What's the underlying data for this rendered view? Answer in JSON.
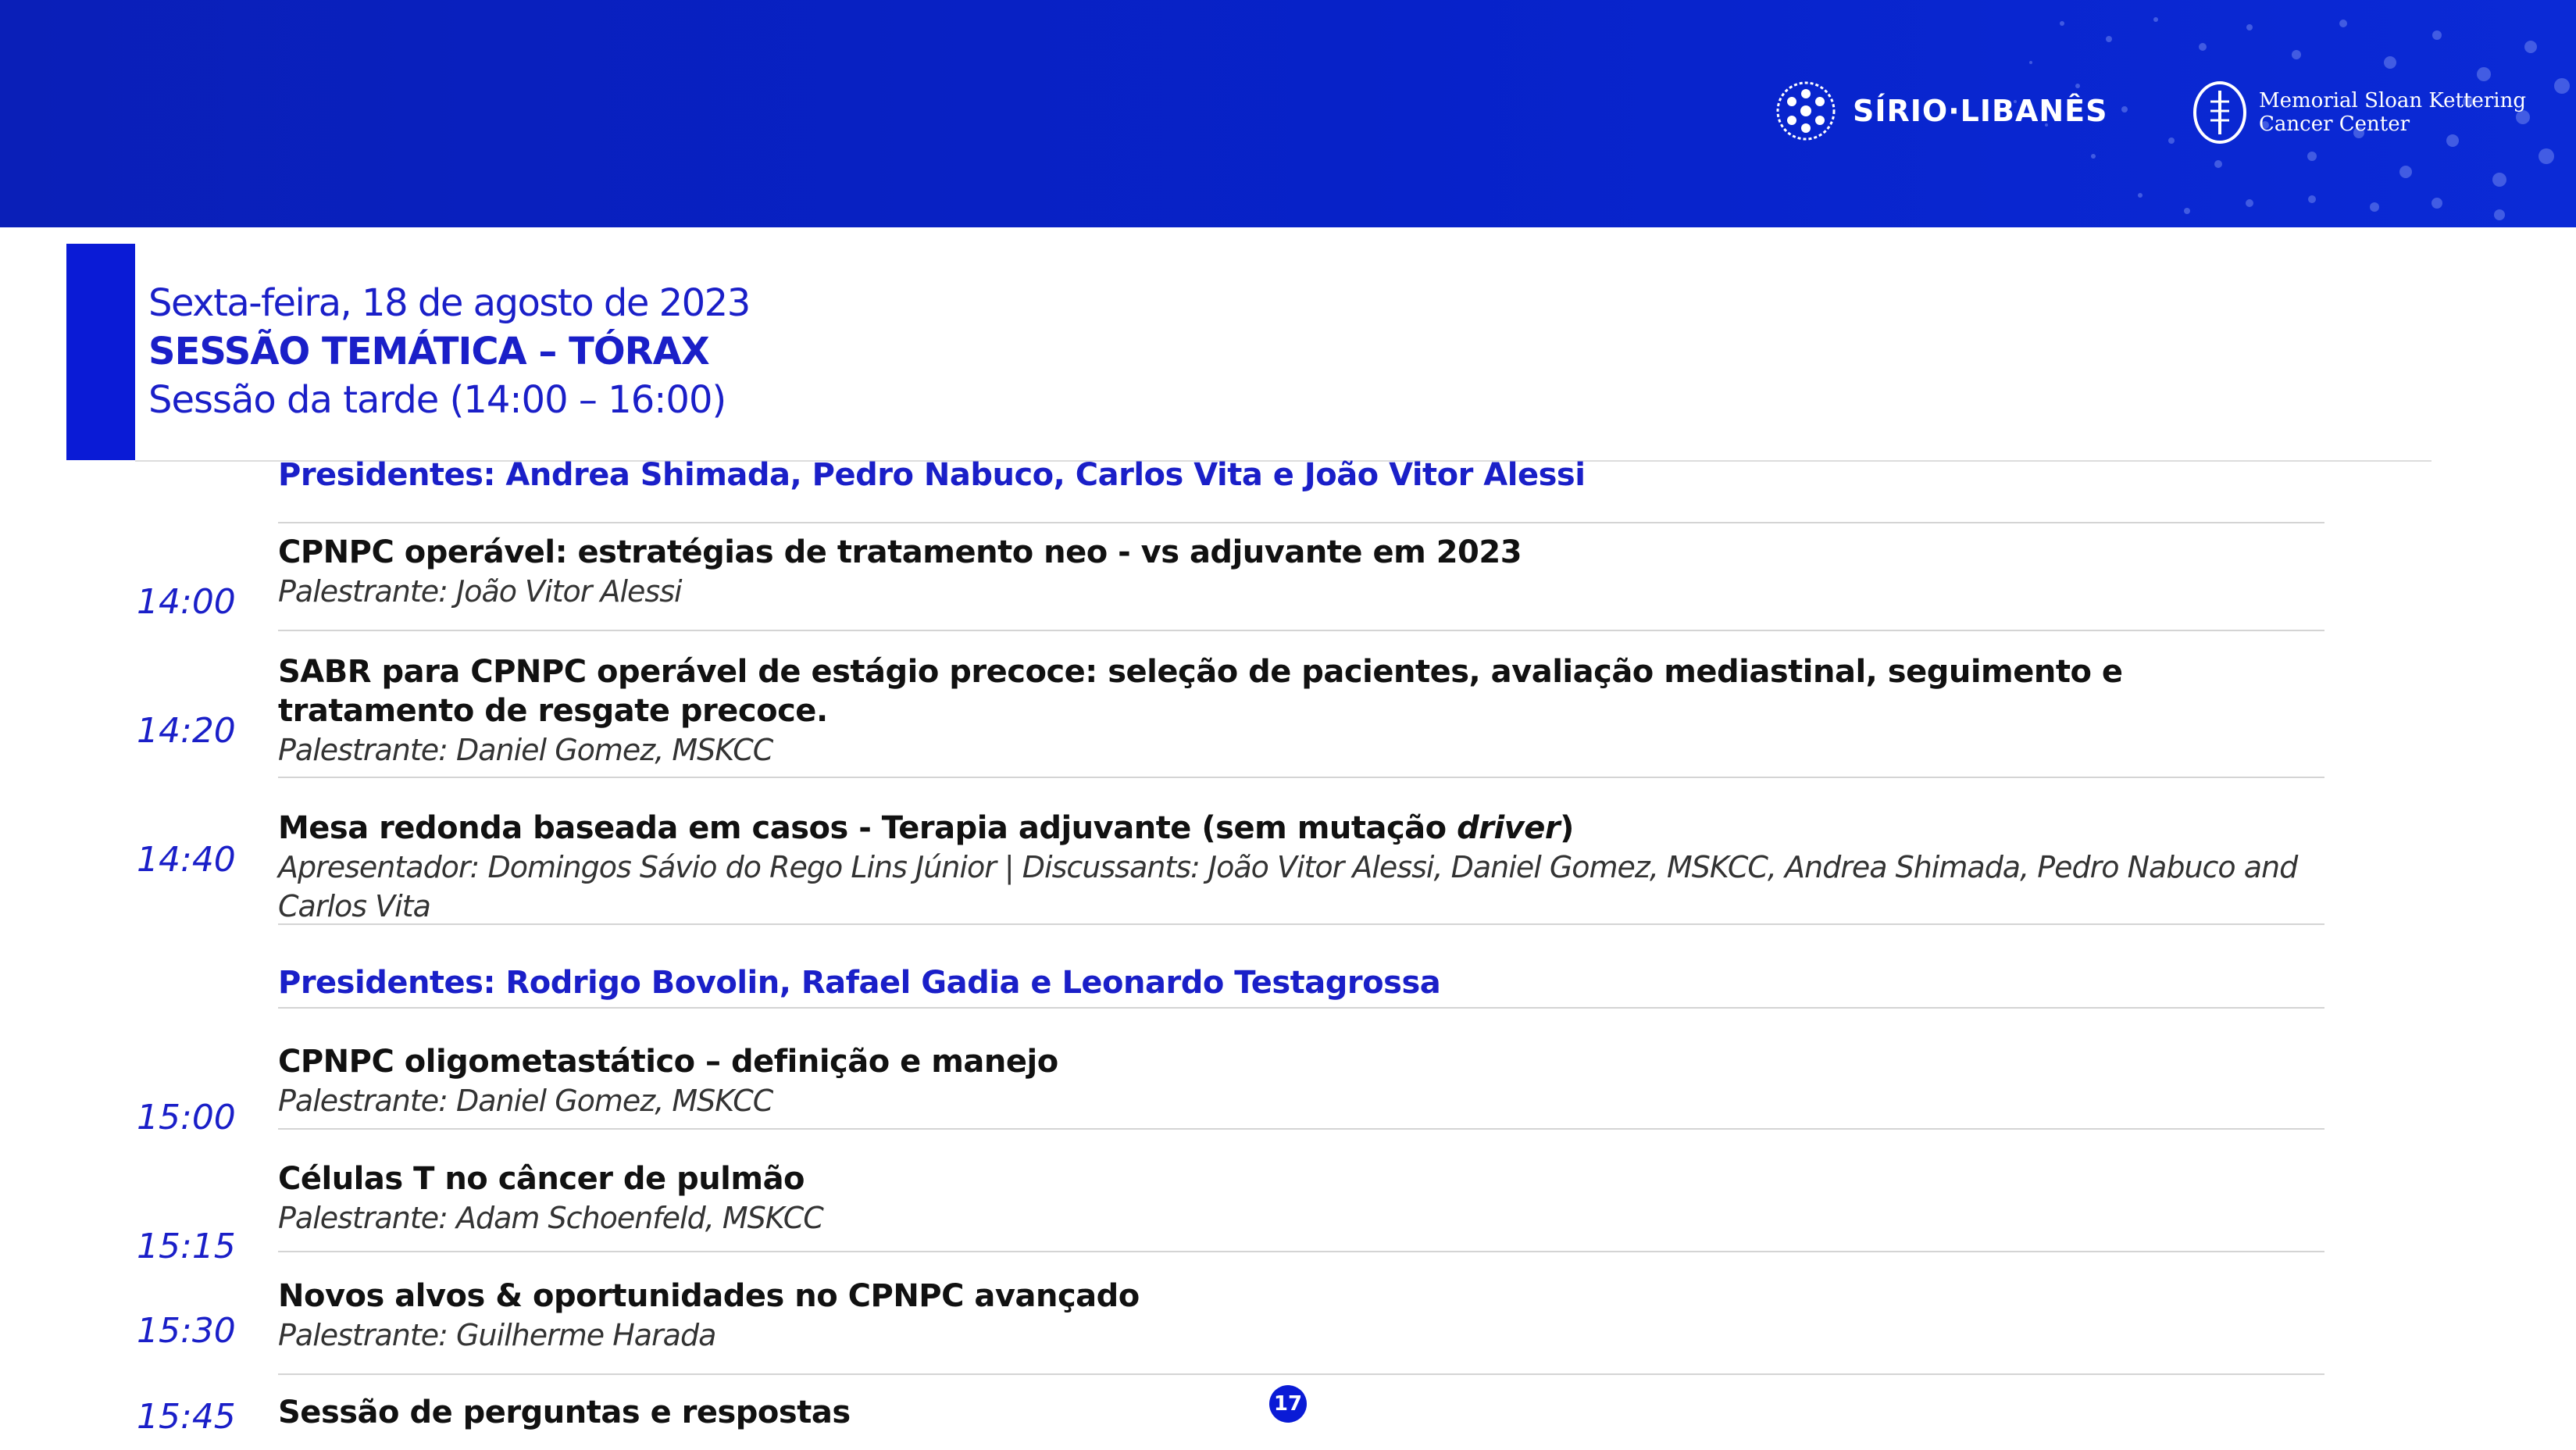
{
  "header": {
    "logo_sirio": "SÍRIO·LIBANÊS",
    "logo_mskcc_line1": "Memorial Sloan Kettering",
    "logo_mskcc_line2": "Cancer Center"
  },
  "session": {
    "date": "Sexta-feira, 18 de agosto de 2023",
    "title": "SESSÃO TEMÁTICA – TÓRAX",
    "time": "Sessão da tarde (14:00 – 16:00)"
  },
  "chairs1": "Presidentes: Andrea Shimada, Pedro Nabuco, Carlos Vita e João Vitor Alessi",
  "items": [
    {
      "time": "14:00",
      "title": "CPNPC operável: estratégias de tratamento neo - vs adjuvante em 2023",
      "speaker": "Palestrante: João Vitor Alessi"
    },
    {
      "time": "14:20",
      "title": "SABR para CPNPC operável de estágio precoce: seleção de pacientes, avaliação mediastinal, seguimento e tratamento de resgate precoce.",
      "speaker": "Palestrante: Daniel Gomez, MSKCC"
    },
    {
      "time": "14:40",
      "title_a": "Mesa redonda baseada em casos - Terapia adjuvante (sem mutação ",
      "title_b": "driver",
      "title_c": ")",
      "speaker": "Apresentador: Domingos Sávio do Rego Lins Júnior | Discussants: João Vitor Alessi, Daniel Gomez, MSKCC, Andrea Shimada, Pedro Nabuco and Carlos Vita"
    },
    {
      "time": "15:00",
      "title": "CPNPC oligometastático – definição e manejo",
      "speaker": "Palestrante: Daniel Gomez, MSKCC"
    },
    {
      "time": "15:15",
      "title": "Células T no câncer de pulmão",
      "speaker": "Palestrante: Adam Schoenfeld, MSKCC"
    },
    {
      "time": "15:30",
      "title": "Novos alvos & oportunidades no CPNPC avançado",
      "speaker": "Palestrante: Guilherme Harada"
    },
    {
      "time": "15:45",
      "title": "Sessão de perguntas e respostas"
    }
  ],
  "chairs2": "Presidentes: Rodrigo Bovolin, Rafael Gadia e Leonardo Testagrossa",
  "page_number": "17"
}
